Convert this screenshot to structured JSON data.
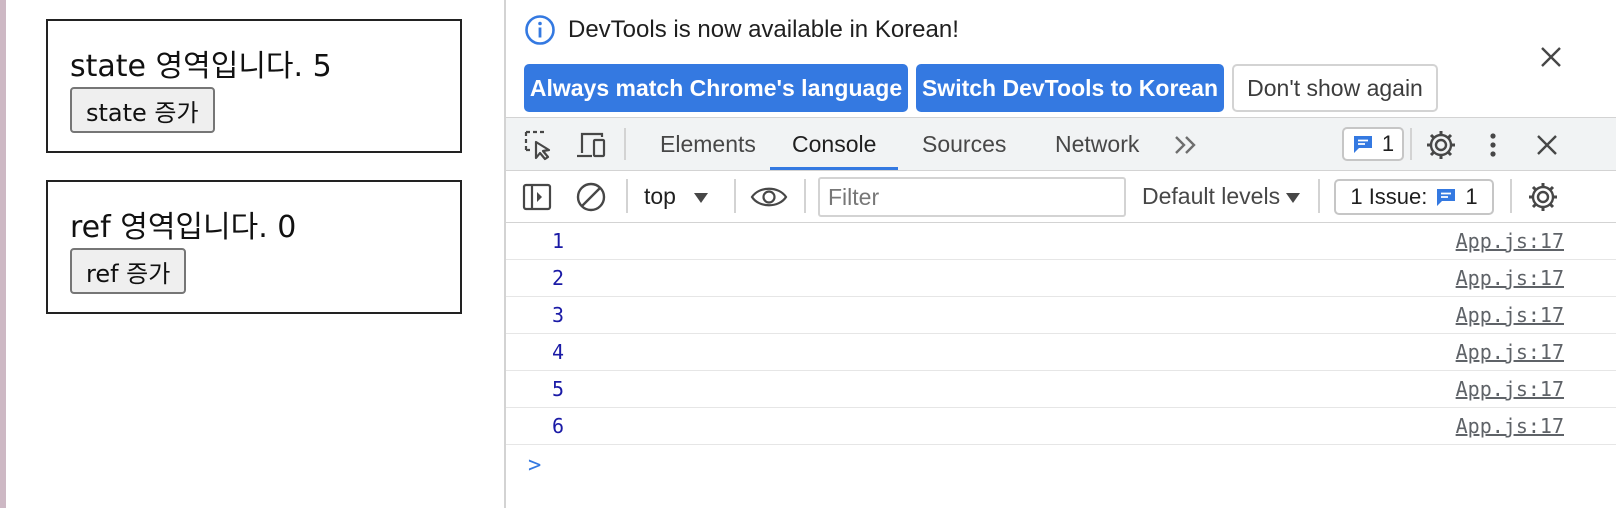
{
  "app": {
    "state_text": "state 영역입니다. 5",
    "state_button": "state 증가",
    "ref_text": "ref 영역입니다. 0",
    "ref_button": "ref 증가"
  },
  "banner": {
    "message": "DevTools is now available in Korean!",
    "buttons": {
      "match": "Always match Chrome's language",
      "switch": "Switch DevTools to Korean",
      "dismiss": "Don't show again"
    }
  },
  "tabs": {
    "elements": "Elements",
    "console": "Console",
    "sources": "Sources",
    "network": "Network",
    "message_count": "1"
  },
  "toolbar": {
    "context": "top",
    "filter_placeholder": "Filter",
    "levels": "Default levels",
    "issues_label": "1 Issue:",
    "issues_count": "1"
  },
  "console_rows": [
    {
      "value": "1",
      "source": "App.js:17"
    },
    {
      "value": "2",
      "source": "App.js:17"
    },
    {
      "value": "3",
      "source": "App.js:17"
    },
    {
      "value": "4",
      "source": "App.js:17"
    },
    {
      "value": "5",
      "source": "App.js:17"
    },
    {
      "value": "6",
      "source": "App.js:17"
    }
  ],
  "prompt_symbol": ">",
  "colors": {
    "accent": "#3479e1",
    "log_value": "#1a1aa6"
  }
}
